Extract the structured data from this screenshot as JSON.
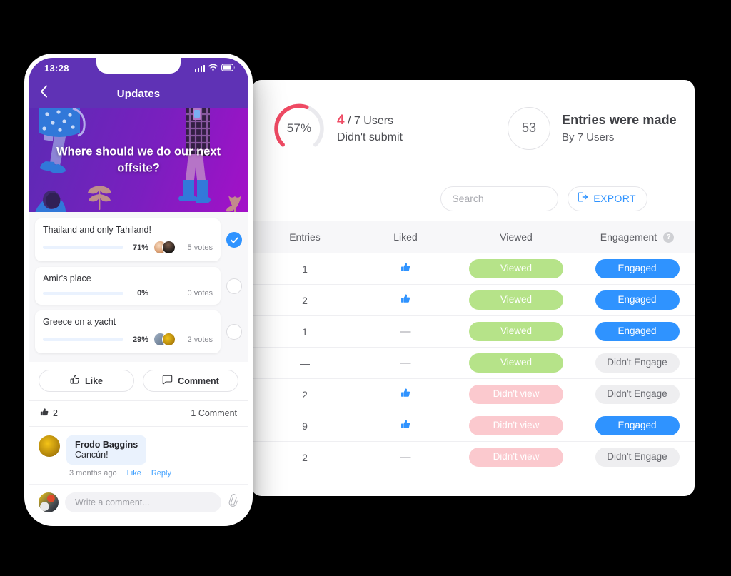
{
  "colors": {
    "accent_blue": "#2f93ff",
    "gauge_red": "#ef4a63",
    "viewed_green": "#b6e389",
    "notview_pink": "#fbc9ce",
    "phone_purple": "#5f32b5",
    "neutral_pill": "#eeeef0"
  },
  "phone": {
    "status": {
      "clock": "13:28",
      "signal_icon": "signal-bars-icon",
      "wifi_icon": "wifi-icon",
      "battery_icon": "battery-icon"
    },
    "nav": {
      "back_icon": "chevron-left-icon",
      "title": "Updates"
    },
    "banner": {
      "question": "Where should we do our next offsite?"
    },
    "poll": [
      {
        "label": "Thailand and only Tahiland!",
        "percent": "71%",
        "percent_value": 71,
        "votes": "5 votes",
        "selected": true,
        "avatars": 2
      },
      {
        "label": "Amir's place",
        "percent": "0%",
        "percent_value": 0,
        "votes": "0 votes",
        "selected": false,
        "avatars": 0
      },
      {
        "label": "Greece on a yacht",
        "percent": "29%",
        "percent_value": 29,
        "votes": "2 votes",
        "selected": false,
        "avatars": 2
      }
    ],
    "actions": {
      "like_label": "Like",
      "like_icon": "thumbs-up-outline-icon",
      "comment_label": "Comment",
      "comment_icon": "speech-bubble-icon"
    },
    "counts": {
      "like_icon": "thumbs-up-filled-icon",
      "like_count": "2",
      "comments": "1 Comment"
    },
    "comment": {
      "author": "Frodo Baggins",
      "text": "Cancún!",
      "time": "3 months ago",
      "like_label": "Like",
      "reply_label": "Reply"
    },
    "composer": {
      "placeholder": "Write a comment...",
      "attach_icon": "paperclip-icon"
    }
  },
  "dashboard": {
    "stats": [
      {
        "gauge_label": "57%",
        "gauge_value": 57,
        "big_number": "4",
        "line1_rest": " / 7 Users",
        "line2": "Didn't submit"
      },
      {
        "circle_number": "53",
        "heading": "Entries were made",
        "subtext": "By 7 Users"
      }
    ],
    "toolbar": {
      "search_placeholder": "Search",
      "search_value": "",
      "search_icon": "search-icon",
      "export_label": "EXPORT",
      "export_icon": "export-arrow-icon"
    },
    "table": {
      "columns": [
        "Entries",
        "Liked",
        "Viewed",
        "Engagement"
      ],
      "help_icon": "help-circle-icon",
      "rows": [
        {
          "entries": "1",
          "liked": "thumbs-up",
          "viewed": "Viewed",
          "viewed_state": "viewed",
          "engagement": "Engaged",
          "engagement_state": "engaged"
        },
        {
          "entries": "2",
          "liked": "thumbs-up",
          "viewed": "Viewed",
          "viewed_state": "viewed",
          "engagement": "Engaged",
          "engagement_state": "engaged"
        },
        {
          "entries": "1",
          "liked": "dash",
          "viewed": "Viewed",
          "viewed_state": "viewed",
          "engagement": "Engaged",
          "engagement_state": "engaged"
        },
        {
          "entries": "—",
          "liked": "dash",
          "viewed": "Viewed",
          "viewed_state": "viewed",
          "engagement": "Didn't Engage",
          "engagement_state": "notengaged"
        },
        {
          "entries": "2",
          "liked": "thumbs-up",
          "viewed": "Didn't view",
          "viewed_state": "notview",
          "engagement": "Didn't Engage",
          "engagement_state": "notengaged"
        },
        {
          "entries": "9",
          "liked": "thumbs-up",
          "viewed": "Didn't view",
          "viewed_state": "notview",
          "engagement": "Engaged",
          "engagement_state": "engaged"
        },
        {
          "entries": "2",
          "liked": "dash",
          "viewed": "Didn't view",
          "viewed_state": "notview",
          "engagement": "Didn't Engage",
          "engagement_state": "notengaged"
        }
      ]
    }
  }
}
